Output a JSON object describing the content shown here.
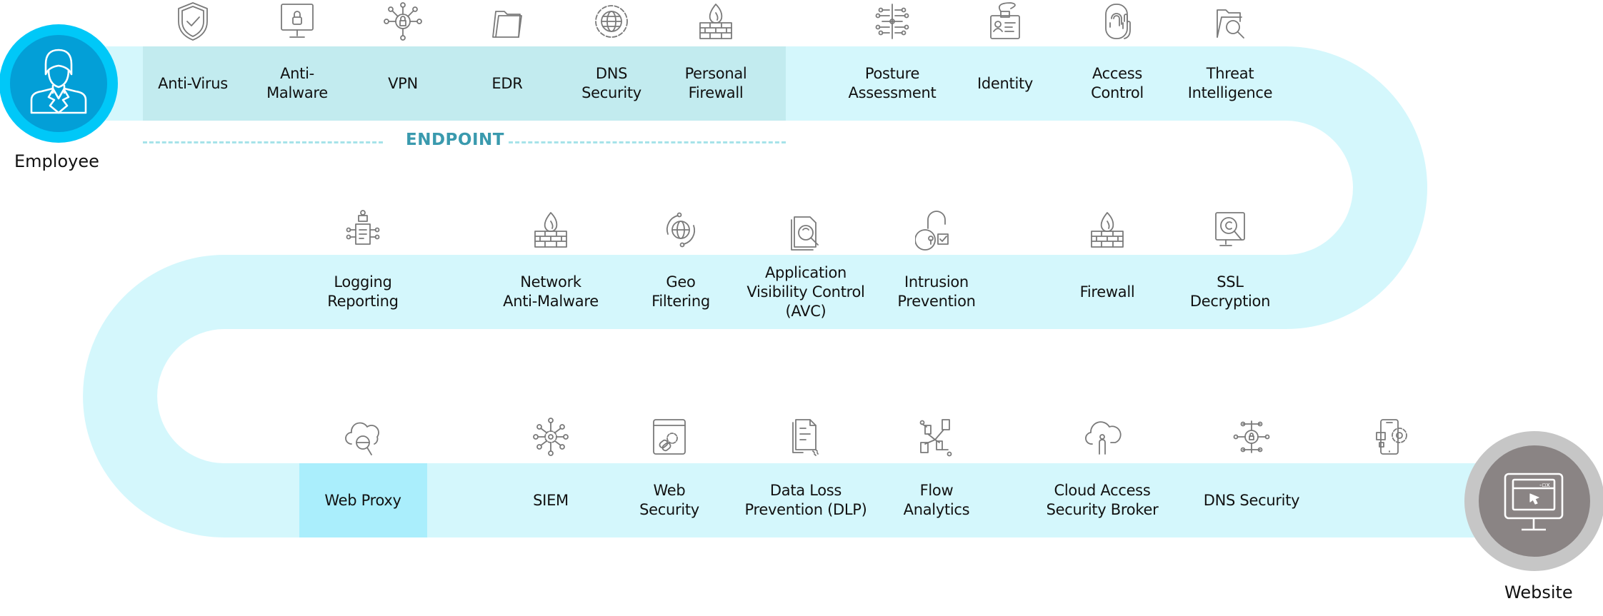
{
  "diagram": {
    "title": "Security stack flow from Employee to Website",
    "colors": {
      "band": "#d4f7fc",
      "endpoint_highlight": "#c2ebef",
      "web_proxy_highlight": "#aaeefc",
      "employee_outer": "#00c8f8",
      "employee_inner": "#039fd7",
      "website_outer": "#c6c6c6",
      "website_inner": "#8a8484",
      "section_title": "#3a9aae",
      "icon_stroke": "#7a7a7a"
    },
    "start": {
      "label": "Employee",
      "icon": "employee-icon"
    },
    "end": {
      "label": "Website",
      "icon": "monitor-browser-icon"
    },
    "section": {
      "label": "ENDPOINT"
    },
    "rows": [
      {
        "name": "top",
        "items": [
          {
            "label": "Anti-Virus",
            "icon": "shield-check-icon",
            "group": "endpoint"
          },
          {
            "label": "Anti-\nMalware",
            "icon": "monitor-lock-icon",
            "group": "endpoint"
          },
          {
            "label": "VPN",
            "icon": "network-lock-icon",
            "group": "endpoint"
          },
          {
            "label": "EDR",
            "icon": "folder-icon",
            "group": "endpoint"
          },
          {
            "label": "DNS\nSecurity",
            "icon": "gear-globe-icon",
            "group": "endpoint"
          },
          {
            "label": "Personal\nFirewall",
            "icon": "firewall-icon",
            "group": "endpoint"
          },
          {
            "label": "Posture\nAssessment",
            "icon": "circuit-icon"
          },
          {
            "label": "Identity",
            "icon": "id-badge-icon"
          },
          {
            "label": "Access\nControl",
            "icon": "fingerprint-hand-icon"
          },
          {
            "label": "Threat\nIntelligence",
            "icon": "folder-search-icon"
          }
        ]
      },
      {
        "name": "middle",
        "items": [
          {
            "label": "Logging\nReporting",
            "icon": "report-network-icon"
          },
          {
            "label": "Network\nAnti-Malware",
            "icon": "firewall-icon"
          },
          {
            "label": "Geo\nFiltering",
            "icon": "globe-orbit-icon"
          },
          {
            "label": "Application\nVisibility Control\n(AVC)",
            "icon": "document-search-icon"
          },
          {
            "label": "Intrusion\nPrevention",
            "icon": "padlock-check-icon"
          },
          {
            "label": "Firewall",
            "icon": "firewall-icon"
          },
          {
            "label": "SSL\nDecryption",
            "icon": "monitor-search-icon"
          }
        ]
      },
      {
        "name": "bottom",
        "items": [
          {
            "label": "Web Proxy",
            "icon": "cloud-search-icon",
            "highlight": true
          },
          {
            "label": "SIEM",
            "icon": "gear-network-icon"
          },
          {
            "label": "Web\nSecurity",
            "icon": "browser-gear-icon"
          },
          {
            "label": "Data Loss\nPrevention (DLP)",
            "icon": "document-leak-icon"
          },
          {
            "label": "Flow\nAnalytics",
            "icon": "flow-nodes-icon"
          },
          {
            "label": "Cloud Access\nSecurity Broker",
            "icon": "cloud-user-icon"
          },
          {
            "label": "DNS Security",
            "icon": "lock-network-icon"
          },
          {
            "label": "",
            "icon": "mobile-gear-icon"
          }
        ]
      }
    ]
  }
}
